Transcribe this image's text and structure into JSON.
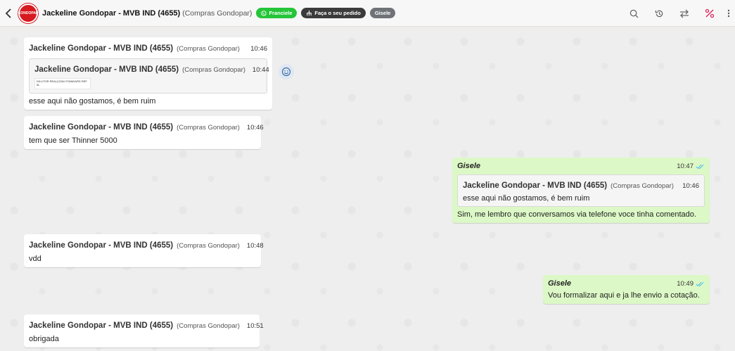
{
  "header": {
    "contact_name": "Jackeline Gondopar - MVB IND (4655)",
    "contact_group": "(Compras Gondopar)",
    "avatar_text": "GONDOPAR",
    "tags": [
      {
        "label": "Franciele",
        "color": "#25c53a",
        "icon": "whatsapp-icon"
      },
      {
        "label": "Faça o seu pedido",
        "color": "#3b3b3b",
        "icon": "flow-icon"
      },
      {
        "label": "Gisele",
        "color": "#6f7377",
        "icon": ""
      }
    ],
    "actions": [
      "search-icon",
      "history-icon",
      "transfer-icon",
      "percent-icon",
      "more-icon"
    ]
  },
  "messages": [
    {
      "direction": "in",
      "sender": "Jackeline Gondopar - MVB IND (4655)",
      "group": "(Compras Gondopar)",
      "time": "10:46",
      "quote": {
        "sender": "Jackeline Gondopar - MVB IND (4655)",
        "group": "(Compras Gondopar)",
        "time": "10:44",
        "image_text": "DILUTOR REALÇZAN STANDARD REF. 5L"
      },
      "text": "esse aqui não gostamos, é bem ruim"
    },
    {
      "direction": "in",
      "sender": "Jackeline Gondopar - MVB IND (4655)",
      "group": "(Compras Gondopar)",
      "time": "10:46",
      "text": "tem que ser Thinner 5000"
    },
    {
      "direction": "out",
      "sender": "Gisele",
      "time": "10:47",
      "quote": {
        "sender": "Jackeline Gondopar - MVB IND (4655)",
        "group": "(Compras Gondopar)",
        "time": "10:46",
        "text": "esse aqui não gostamos, é bem ruim"
      },
      "text": "Sim, me lembro que conversamos via telefone voce tinha comentado."
    },
    {
      "direction": "in",
      "sender": "Jackeline Gondopar - MVB IND (4655)",
      "group": "(Compras Gondopar)",
      "time": "10:48",
      "text": "vdd"
    },
    {
      "direction": "out",
      "sender": "Gisele",
      "time": "10:49",
      "text": "Vou formalizar aqui e ja lhe envio a cotação."
    },
    {
      "direction": "in",
      "sender": "Jackeline Gondopar - MVB IND (4655)",
      "group": "(Compras Gondopar)",
      "time": "10:51",
      "text": "obrigada"
    }
  ],
  "colors": {
    "outgoing_bubble": "#dcf8c6",
    "incoming_bubble": "#ffffff",
    "read_ticks": "#53bdeb",
    "brand_red": "#d71920"
  }
}
